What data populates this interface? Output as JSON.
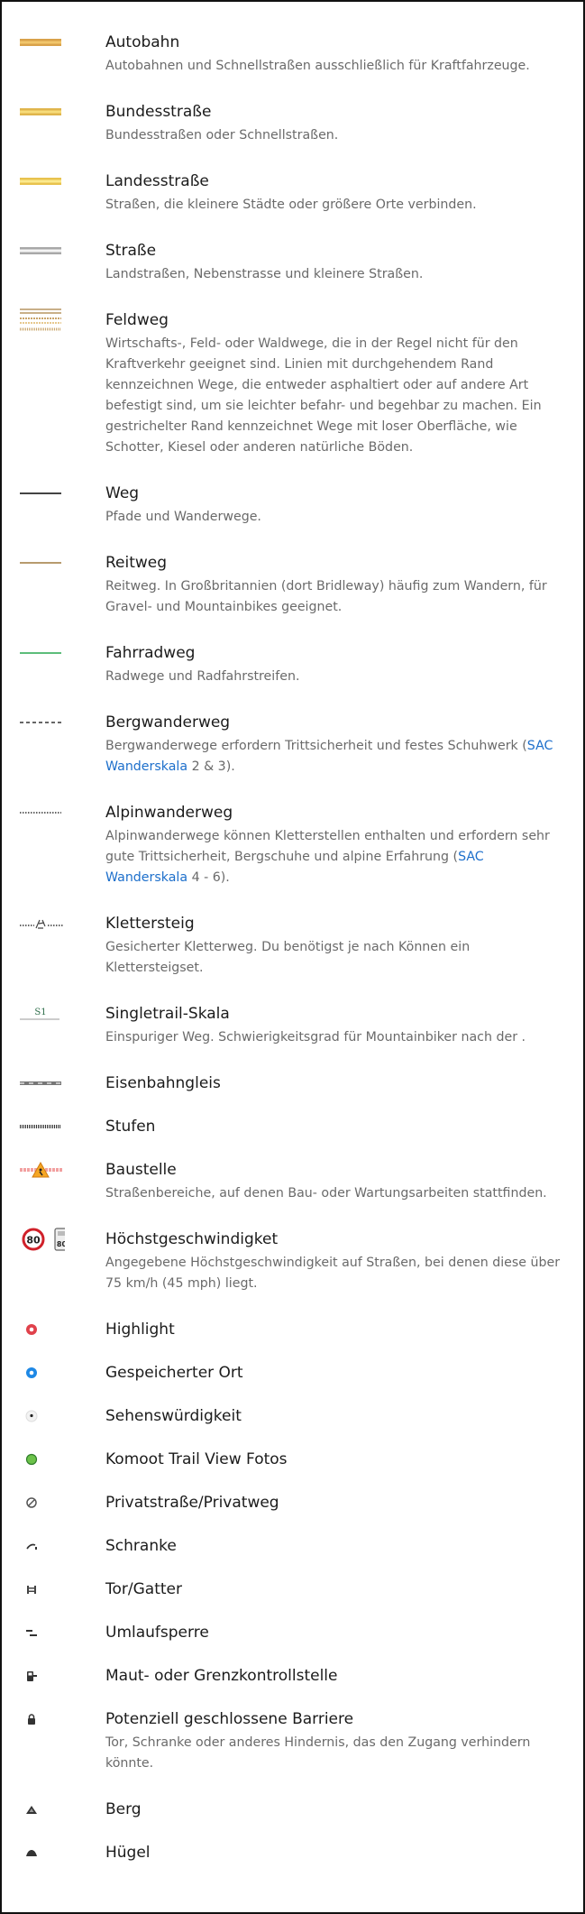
{
  "colors": {
    "title": "#1b1b1b",
    "description": "#6a6a6a",
    "link": "#1d6fcb"
  },
  "legend": [
    {
      "icon": "autobahn-line-icon",
      "title": "Autobahn",
      "desc": [
        {
          "text": "Autobahnen und Schnellstraßen ausschließlich für Kraftfahrzeuge."
        }
      ]
    },
    {
      "icon": "bundesstrasse-line-icon",
      "title": "Bundesstraße",
      "desc": [
        {
          "text": "Bundesstraßen oder Schnellstraßen."
        }
      ]
    },
    {
      "icon": "landesstrasse-line-icon",
      "title": "Landesstraße",
      "desc": [
        {
          "text": "Straßen, die kleinere Städte oder größere Orte verbinden."
        }
      ]
    },
    {
      "icon": "strasse-line-icon",
      "title": "Straße",
      "desc": [
        {
          "text": "Landstraßen, Nebenstrasse und kleinere Straßen."
        }
      ]
    },
    {
      "icon": "feldweg-line-icon",
      "title": "Feldweg",
      "desc": [
        {
          "text": "Wirtschafts-, Feld- oder Waldwege, die in der Regel nicht für den Kraftverkehr geeignet sind. Linien mit durchgehendem Rand kennzeichnen Wege, die entweder asphaltiert oder auf andere Art befestigt sind, um sie leichter befahr- und begehbar zu machen. Ein gestrichelter Rand kennzeichnet Wege mit loser Oberfläche, wie Schotter, Kiesel oder anderen natürliche Böden."
        }
      ]
    },
    {
      "icon": "weg-line-icon",
      "title": "Weg",
      "desc": [
        {
          "text": "Pfade und Wanderwege."
        }
      ]
    },
    {
      "icon": "reitweg-line-icon",
      "title": "Reitweg",
      "desc": [
        {
          "text": "Reitweg. In Großbritannien (dort Bridleway) häufig zum Wandern, für Gravel- und Mountainbikes geeignet."
        }
      ]
    },
    {
      "icon": "fahrradweg-line-icon",
      "title": "Fahrradweg",
      "desc": [
        {
          "text": "Radwege und Radfahrstreifen."
        }
      ]
    },
    {
      "icon": "bergwanderweg-dashed-icon",
      "title": "Bergwanderweg",
      "desc": [
        {
          "text": "Bergwanderwege erfordern Trittsicherheit und festes Schuhwerk ("
        },
        {
          "text": "SAC Wanderskala",
          "link": true
        },
        {
          "text": " 2 & 3)."
        }
      ]
    },
    {
      "icon": "alpinwanderweg-dotted-icon",
      "title": "Alpinwanderweg",
      "desc": [
        {
          "text": "Alpinwanderwege können Kletterstellen enthalten und erfordern sehr gute Trittsicherheit, Bergschuhe und alpine Erfahrung ("
        },
        {
          "text": "SAC Wanderskala",
          "link": true
        },
        {
          "text": " 4 - 6)."
        }
      ]
    },
    {
      "icon": "klettersteig-icon",
      "title": "Klettersteig",
      "desc": [
        {
          "text": "Gesicherter Kletterweg. Du benötigst je nach Können ein Klettersteigset."
        }
      ]
    },
    {
      "icon": "singletrail-s1-icon",
      "icon_text": "S1",
      "title": "Singletrail-Skala",
      "desc": [
        {
          "text": "Einspuriger Weg. Schwierigkeitsgrad für Mountainbiker nach der ."
        }
      ]
    },
    {
      "icon": "railway-line-icon",
      "title": "Eisenbahngleis",
      "desc": []
    },
    {
      "icon": "steps-line-icon",
      "title": "Stufen",
      "desc": []
    },
    {
      "icon": "construction-sign-icon",
      "title": "Baustelle",
      "desc": [
        {
          "text": "Straßenbereiche, auf denen Bau- oder Wartungsarbeiten stattfinden."
        }
      ]
    },
    {
      "icon": "speed-limit-icon",
      "icon_text": "80",
      "title": "Höchstgeschwindigket",
      "desc": [
        {
          "text": "Angegebene Höchstgeschwindigkeit auf Straßen, bei denen diese über 75 km/h (45 mph) liegt."
        }
      ]
    },
    {
      "icon": "highlight-marker-icon",
      "title": "Highlight",
      "desc": []
    },
    {
      "icon": "saved-place-marker-icon",
      "title": "Gespeicherter Ort",
      "desc": []
    },
    {
      "icon": "poi-marker-icon",
      "title": "Sehenswürdigkeit",
      "desc": []
    },
    {
      "icon": "trail-view-marker-icon",
      "title": "Komoot Trail View Fotos",
      "desc": []
    },
    {
      "icon": "private-road-icon",
      "title": "Privatstraße/Privatweg",
      "desc": []
    },
    {
      "icon": "barrier-boom-icon",
      "title": "Schranke",
      "desc": []
    },
    {
      "icon": "gate-icon",
      "title": "Tor/Gatter",
      "desc": []
    },
    {
      "icon": "cycle-barrier-icon",
      "title": "Umlaufsperre",
      "desc": []
    },
    {
      "icon": "toll-booth-icon",
      "title": "Maut- oder Grenzkontrollstelle",
      "desc": []
    },
    {
      "icon": "lock-icon",
      "title": "Potenziell geschlossene Barriere",
      "desc": [
        {
          "text": "Tor, Schranke oder anderes Hindernis, das den Zugang verhindern könnte."
        }
      ]
    },
    {
      "icon": "peak-icon",
      "title": "Berg",
      "desc": []
    },
    {
      "icon": "hill-icon",
      "title": "Hügel",
      "desc": []
    }
  ]
}
